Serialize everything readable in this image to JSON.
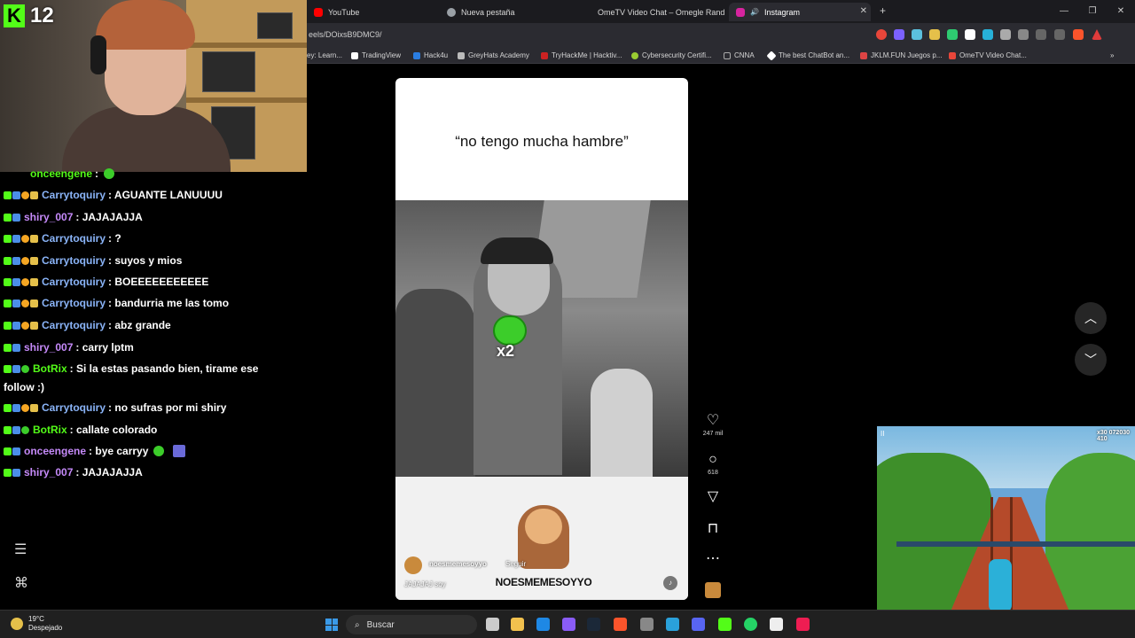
{
  "stream": {
    "kick_viewers": "12"
  },
  "browser": {
    "tabs": [
      {
        "label": "YouTube",
        "color": "#ff0000"
      },
      {
        "label": "Nueva pestaña",
        "color": "#9aa0a6"
      },
      {
        "label": "OmeTV Video Chat – Omegle Rand",
        "color": "#e8463a"
      },
      {
        "label": "Instagram",
        "color": "#d6249f"
      }
    ],
    "url": "eels/DOixsB9DMC9/",
    "bookmarks": [
      {
        "label": "ey: Learn...",
        "color": "#888888"
      },
      {
        "label": "TradingView",
        "color": "#ffffff"
      },
      {
        "label": "Hack4u",
        "color": "#2a7de1"
      },
      {
        "label": "GreyHats Academy",
        "color": "#bbbbbb"
      },
      {
        "label": "TryHackMe | Hacktiv...",
        "color": "#cc2222"
      },
      {
        "label": "Cybersecurity Certifi...",
        "color": "#9acd32"
      },
      {
        "label": "CNNA",
        "color": "#aaaaaa"
      },
      {
        "label": "The best ChatBot an...",
        "color": "#ffffff"
      },
      {
        "label": "JKLM.FUN Juegos p...",
        "color": "#d44444"
      },
      {
        "label": "OmeTV Video Chat...",
        "color": "#e8463a"
      }
    ]
  },
  "chat": {
    "messages": [
      {
        "user": "onceengene",
        "text": ":",
        "user_color": "#53fc18"
      },
      {
        "user": "Carrytoquiry",
        "text": ": AGUANTE LANUUUU",
        "user_color": "#8ab4f8"
      },
      {
        "user": "shiry_007",
        "text": ": JAJAJAJJA",
        "user_color": "#c58af9"
      },
      {
        "user": "Carrytoquiry",
        "text": ": ?",
        "user_color": "#8ab4f8"
      },
      {
        "user": "Carrytoquiry",
        "text": ": suyos y mios",
        "user_color": "#8ab4f8"
      },
      {
        "user": "Carrytoquiry",
        "text": ": BOEEEEEEEEEEE",
        "user_color": "#8ab4f8"
      },
      {
        "user": "Carrytoquiry",
        "text": ": bandurria me las tomo",
        "user_color": "#8ab4f8"
      },
      {
        "user": "Carrytoquiry",
        "text": ": abz grande",
        "user_color": "#8ab4f8"
      },
      {
        "user": "shiry_007",
        "text": ": carry lptm",
        "user_color": "#c58af9"
      },
      {
        "user": "BotRix",
        "text": ": Si la estas pasando bien, tirame ese",
        "user_color": "#53fc18"
      },
      {
        "user": "",
        "text": "follow :)",
        "user_color": "#ffffff"
      },
      {
        "user": "Carrytoquiry",
        "text": ": no sufras por mi shiry",
        "user_color": "#8ab4f8"
      },
      {
        "user": "BotRix",
        "text": ": callate colorado",
        "user_color": "#53fc18"
      },
      {
        "user": "onceengene",
        "text": ": bye carryy",
        "user_color": "#c58af9"
      },
      {
        "user": "shiry_007",
        "text": ": JAJAJAJJA",
        "user_color": "#c58af9"
      }
    ]
  },
  "reel": {
    "caption": "“no tengo mucha hambre”",
    "emote_text": "x2",
    "brand": "NOESMEMESOYYO",
    "author": "noesmemesoyyo",
    "follow_label": "Seguir",
    "description": "JAJAJAJ soy",
    "likes": "247 mil",
    "comments": "618"
  },
  "game": {
    "score_left": "x30",
    "score_right": "072030",
    "coins": "410"
  },
  "taskbar": {
    "temperature": "19°C",
    "weather": "Despejado",
    "search_placeholder": "Buscar"
  }
}
